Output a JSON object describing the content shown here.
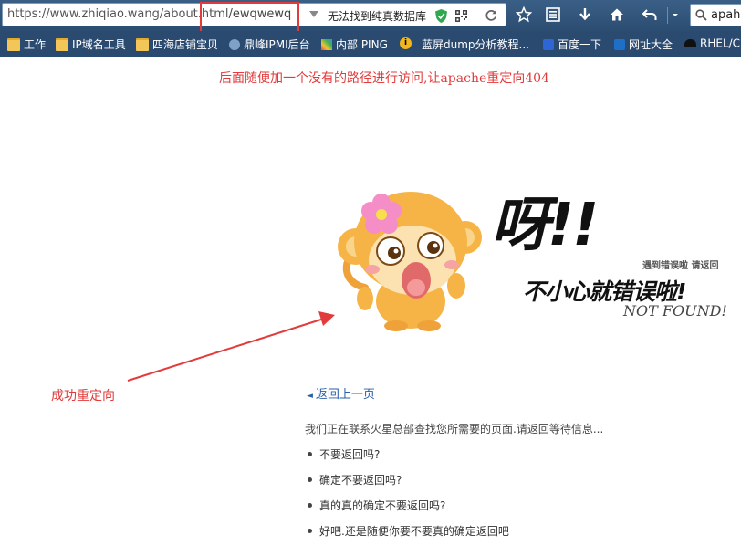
{
  "address_bar": {
    "url_base": "https://www.zhiqiao.wang/about.html",
    "url_extra": "/ewqwewq",
    "notice": "无法找到纯真数据库",
    "search_value": "apah"
  },
  "bookmarks": [
    {
      "label": "工作",
      "icon": "folder-icon"
    },
    {
      "label": "IP域名工具",
      "icon": "folder-icon"
    },
    {
      "label": "四海店铺宝贝",
      "icon": "folder-icon"
    },
    {
      "label": "鼎峰IPMI后台",
      "icon": "globe-icon"
    },
    {
      "label": "内部 PING",
      "icon": "app-icon"
    },
    {
      "label": "",
      "icon": "info-icon"
    },
    {
      "label": "蓝屏dump分析教程...",
      "icon": "page-icon"
    },
    {
      "label": "百度一下",
      "icon": "baidu-icon"
    },
    {
      "label": "网址大全",
      "icon": "outlook-icon"
    },
    {
      "label": "RHEL/C",
      "icon": "hat-icon"
    }
  ],
  "annotations": {
    "top": "后面随便加一个没有的路径进行访问,让apache重定向404",
    "left": "成功重定向"
  },
  "error_graphic": {
    "big": "呀!!",
    "small": "遇到错误啦 请返回",
    "main": "不小心就错误啦!",
    "en": "NOT FOUND!"
  },
  "page": {
    "back_link": "返回上一页",
    "message": "我们正在联系火星总部查找您所需要的页面.请返回等待信息...",
    "options": [
      "不要返回吗?",
      "确定不要返回吗?",
      "真的真的确定不要返回吗?",
      "好吧.还是随便你要不要真的确定返回吧"
    ]
  }
}
